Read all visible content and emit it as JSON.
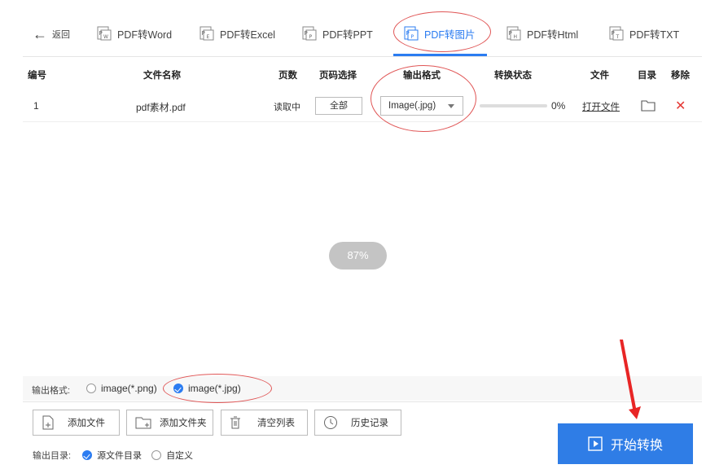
{
  "nav": {
    "back_label": "返回",
    "tabs": [
      {
        "label": "PDF转Word",
        "active": false
      },
      {
        "label": "PDF转Excel",
        "active": false
      },
      {
        "label": "PDF转PPT",
        "active": false
      },
      {
        "label": "PDF转图片",
        "active": true
      },
      {
        "label": "PDF转Html",
        "active": false
      },
      {
        "label": "PDF转TXT",
        "active": false
      }
    ],
    "accent": "#2b7cf1"
  },
  "table": {
    "headers": [
      "编号",
      "文件名称",
      "页数",
      "页码选择",
      "输出格式",
      "转换状态",
      "文件",
      "目录",
      "移除"
    ],
    "rows": [
      {
        "index": "1",
        "filename": "pdf素材.pdf",
        "pages": "读取中",
        "page_select": "全部",
        "format": "Image(.jpg)",
        "progress": 0,
        "progress_text": "0%",
        "open_file": "打开文件"
      }
    ]
  },
  "loading_text": "87%",
  "output_format": {
    "label": "输出格式:",
    "options": [
      {
        "label": "image(*.png)",
        "selected": false
      },
      {
        "label": "image(*.jpg)",
        "selected": true
      }
    ]
  },
  "buttons": {
    "add_file": "添加文件",
    "add_folder": "添加文件夹",
    "clear_list": "清空列表",
    "history": "历史记录",
    "start": "开始转换"
  },
  "output_dir": {
    "label": "输出目录:",
    "options": [
      {
        "label": "源文件目录",
        "selected": true
      },
      {
        "label": "自定义",
        "selected": false
      }
    ]
  },
  "colors": {
    "primary": "#2f7de6",
    "annotation": "#e05656",
    "remove": "#e53935"
  }
}
